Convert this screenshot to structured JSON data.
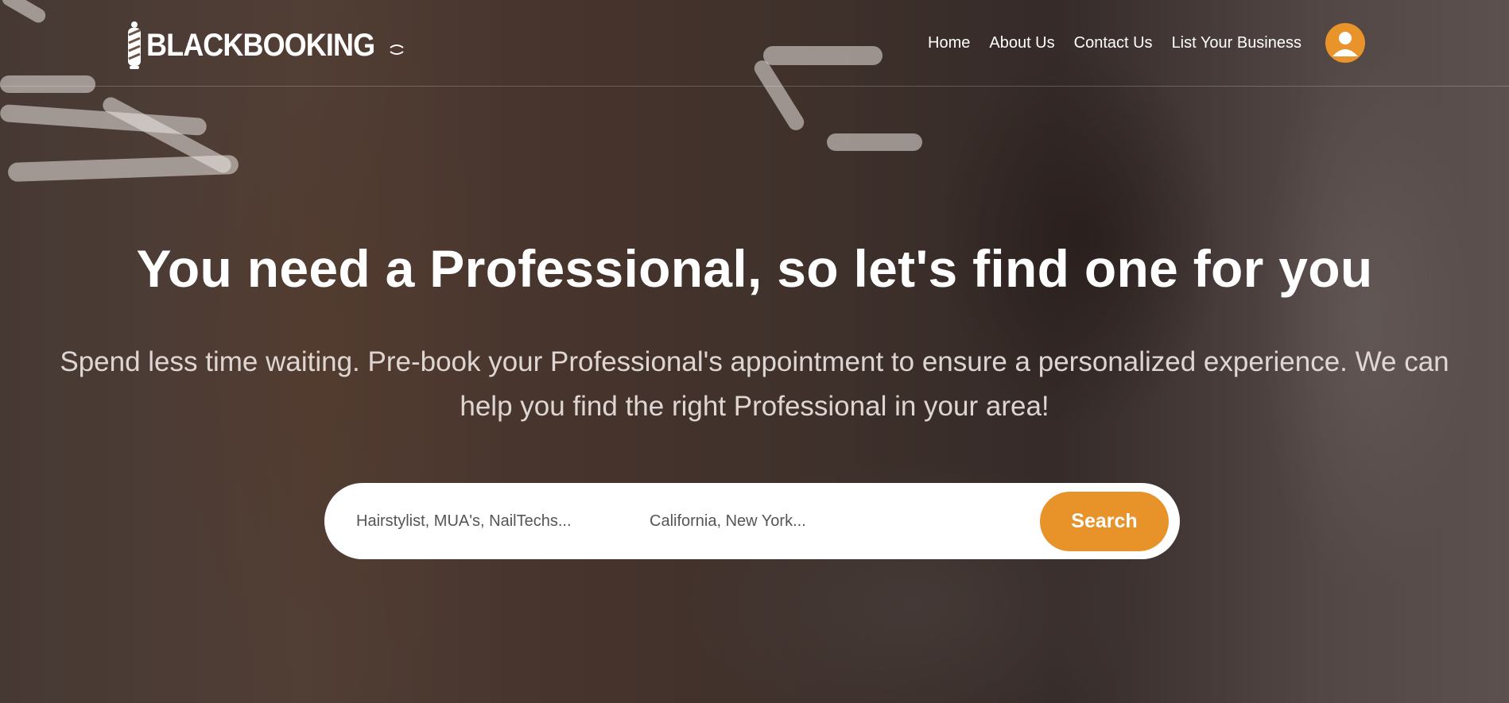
{
  "brand": {
    "name": "BLACKBOOKING",
    "accent_color": "#e8922a"
  },
  "nav": {
    "items": [
      {
        "label": "Home"
      },
      {
        "label": "About Us"
      },
      {
        "label": "Contact Us"
      },
      {
        "label": "List Your Business"
      }
    ],
    "profile_icon": "user-icon"
  },
  "hero": {
    "headline": "You need a Professional, so let's find one for you",
    "subtext": "Spend less time waiting. Pre-book your Professional's appointment to ensure a personalized experience. We can help you find the right Professional in your area!",
    "background_image": "barber-shaving-customer"
  },
  "search": {
    "service_placeholder": "Hairstylist, MUA's, NailTechs...",
    "location_placeholder": "California, New York...",
    "button_label": "Search"
  }
}
